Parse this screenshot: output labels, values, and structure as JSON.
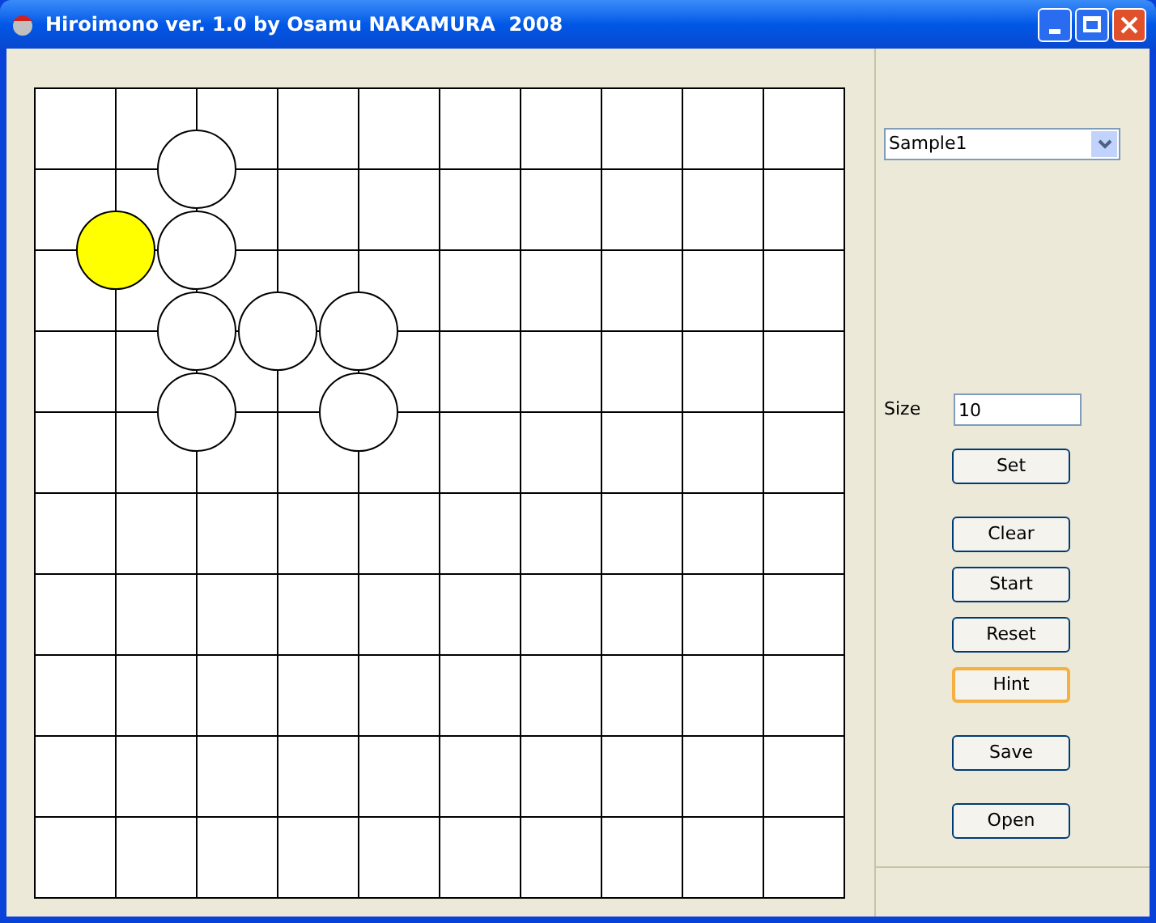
{
  "window": {
    "title": "Hiroimono ver. 1.0 by Osamu NAKAMURA  2008"
  },
  "board": {
    "rows": [
      [
        {
          "kind": "empty"
        },
        {
          "kind": "empty"
        },
        {
          "kind": "empty"
        },
        {
          "kind": "empty"
        },
        {
          "kind": "empty"
        },
        {
          "kind": "empty"
        },
        {
          "kind": "empty"
        },
        {
          "kind": "empty"
        },
        {
          "kind": "empty"
        },
        {
          "kind": "empty"
        },
        {
          "kind": "empty"
        }
      ],
      [
        {
          "kind": "empty"
        },
        {
          "kind": "empty"
        },
        {
          "kind": "stone",
          "selected": false
        },
        {
          "kind": "empty"
        },
        {
          "kind": "empty"
        },
        {
          "kind": "empty"
        },
        {
          "kind": "empty"
        },
        {
          "kind": "empty"
        },
        {
          "kind": "empty"
        },
        {
          "kind": "empty"
        },
        {
          "kind": "empty"
        }
      ],
      [
        {
          "kind": "empty"
        },
        {
          "kind": "stone",
          "selected": true
        },
        {
          "kind": "stone",
          "selected": false
        },
        {
          "kind": "empty"
        },
        {
          "kind": "empty"
        },
        {
          "kind": "empty"
        },
        {
          "kind": "empty"
        },
        {
          "kind": "empty"
        },
        {
          "kind": "empty"
        },
        {
          "kind": "empty"
        },
        {
          "kind": "empty"
        }
      ],
      [
        {
          "kind": "empty"
        },
        {
          "kind": "empty"
        },
        {
          "kind": "stone",
          "selected": false
        },
        {
          "kind": "stone",
          "selected": false
        },
        {
          "kind": "stone",
          "selected": false
        },
        {
          "kind": "empty"
        },
        {
          "kind": "empty"
        },
        {
          "kind": "empty"
        },
        {
          "kind": "empty"
        },
        {
          "kind": "empty"
        },
        {
          "kind": "empty"
        }
      ],
      [
        {
          "kind": "empty"
        },
        {
          "kind": "empty"
        },
        {
          "kind": "stone",
          "selected": false
        },
        {
          "kind": "empty"
        },
        {
          "kind": "stone",
          "selected": false
        },
        {
          "kind": "empty"
        },
        {
          "kind": "empty"
        },
        {
          "kind": "empty"
        },
        {
          "kind": "empty"
        },
        {
          "kind": "empty"
        },
        {
          "kind": "empty"
        }
      ],
      [
        {
          "kind": "empty"
        },
        {
          "kind": "empty"
        },
        {
          "kind": "empty"
        },
        {
          "kind": "empty"
        },
        {
          "kind": "empty"
        },
        {
          "kind": "empty"
        },
        {
          "kind": "empty"
        },
        {
          "kind": "empty"
        },
        {
          "kind": "empty"
        },
        {
          "kind": "empty"
        },
        {
          "kind": "empty"
        }
      ],
      [
        {
          "kind": "empty"
        },
        {
          "kind": "empty"
        },
        {
          "kind": "empty"
        },
        {
          "kind": "empty"
        },
        {
          "kind": "empty"
        },
        {
          "kind": "empty"
        },
        {
          "kind": "empty"
        },
        {
          "kind": "empty"
        },
        {
          "kind": "empty"
        },
        {
          "kind": "empty"
        },
        {
          "kind": "empty"
        }
      ],
      [
        {
          "kind": "empty"
        },
        {
          "kind": "empty"
        },
        {
          "kind": "empty"
        },
        {
          "kind": "empty"
        },
        {
          "kind": "empty"
        },
        {
          "kind": "empty"
        },
        {
          "kind": "empty"
        },
        {
          "kind": "empty"
        },
        {
          "kind": "empty"
        },
        {
          "kind": "empty"
        },
        {
          "kind": "empty"
        }
      ],
      [
        {
          "kind": "empty"
        },
        {
          "kind": "empty"
        },
        {
          "kind": "empty"
        },
        {
          "kind": "empty"
        },
        {
          "kind": "empty"
        },
        {
          "kind": "empty"
        },
        {
          "kind": "empty"
        },
        {
          "kind": "empty"
        },
        {
          "kind": "empty"
        },
        {
          "kind": "empty"
        },
        {
          "kind": "empty"
        }
      ],
      [
        {
          "kind": "empty"
        },
        {
          "kind": "empty"
        },
        {
          "kind": "empty"
        },
        {
          "kind": "empty"
        },
        {
          "kind": "empty"
        },
        {
          "kind": "empty"
        },
        {
          "kind": "empty"
        },
        {
          "kind": "empty"
        },
        {
          "kind": "empty"
        },
        {
          "kind": "empty"
        },
        {
          "kind": "empty"
        }
      ],
      [
        {
          "kind": "empty"
        },
        {
          "kind": "empty"
        },
        {
          "kind": "empty"
        },
        {
          "kind": "empty"
        },
        {
          "kind": "empty"
        },
        {
          "kind": "empty"
        },
        {
          "kind": "empty"
        },
        {
          "kind": "empty"
        },
        {
          "kind": "empty"
        },
        {
          "kind": "empty"
        },
        {
          "kind": "empty"
        }
      ]
    ]
  },
  "puzzle_select": {
    "value": "Sample1"
  },
  "size_field": {
    "label": "Size",
    "value": "10"
  },
  "button_groups": [
    [
      {
        "label": "Set",
        "focused": false
      }
    ],
    [
      {
        "label": "Clear",
        "focused": false
      },
      {
        "label": "Start",
        "focused": false
      },
      {
        "label": "Reset",
        "focused": false
      },
      {
        "label": "Hint",
        "focused": true
      }
    ],
    [
      {
        "label": "Save",
        "focused": false
      }
    ],
    [
      {
        "label": "Open",
        "focused": false
      }
    ]
  ]
}
